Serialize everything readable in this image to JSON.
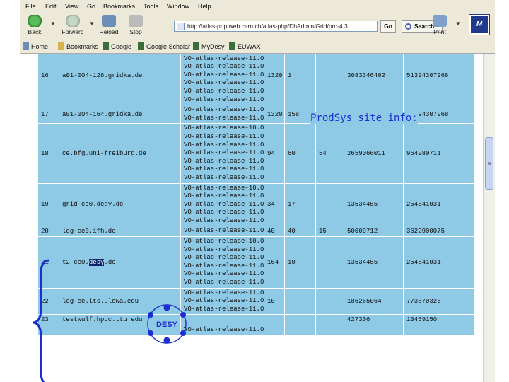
{
  "menu": [
    "File",
    "Edit",
    "View",
    "Go",
    "Bookmarks",
    "Tools",
    "Window",
    "Help"
  ],
  "toolbar": {
    "back": "Back",
    "forward": "Forward",
    "reload": "Reload",
    "stop": "Stop",
    "address": "http://atlas-php.web.cern.ch/atlas-php/DbAdmin/Grid/pro-4.3.",
    "go": "Go",
    "search": "Search",
    "print": "Print"
  },
  "logo": "M",
  "bookmarks": [
    "Home",
    "Bookmarks",
    "Google",
    "Google Scholar",
    "MyDesy",
    "EUWAX"
  ],
  "overlay_title": "ProdSys site info:",
  "desy_logo": "DESY",
  "colors": {
    "table_bg": "#8ecae6",
    "accent": "#1b2fd0",
    "chrome": "#ece9d8"
  },
  "rows": [
    {
      "num": "16",
      "host": "a01-004-128.gridka.de",
      "sw": [
        "VO-atlas-release-10.0.1",
        "VO-atlas-release-11.0.1",
        "VO-atlas-release-11.0.2",
        "VO-atlas-release-11.0.3",
        "VO-atlas-release-11.0.4",
        "VO-atlas-release-11.0.41",
        "VO-atlas-release-11.0.42"
      ],
      "c1": "1320",
      "c2": "1",
      "c3": "",
      "c4": "3083346402",
      "c5": "51394307968"
    },
    {
      "num": "17",
      "host": "a01-004-164.gridka.de",
      "sw": [
        "VO-atlas-release-11.0.2",
        "VO-atlas-release-11.0.3"
      ],
      "c1": "1320",
      "c2": "158",
      "c3": "",
      "c4": "3083346402",
      "c5": "51394307968"
    },
    {
      "num": "18",
      "host": "ce.bfg.uni-freiburg.de",
      "sw": [
        "VO-atlas-release-10.0.4",
        "VO-atlas-release-11.0.1",
        "VO-atlas-release-11.0.2",
        "VO-atlas-release-11.0.3",
        "VO-atlas-release-11.0.4",
        "VO-atlas-release-11.0.41",
        "VO-atlas-release-11.0.42"
      ],
      "c1": "94",
      "c2": "60",
      "c3": "54",
      "c4": "2659066011",
      "c5": "964980711"
    },
    {
      "num": "19",
      "host": "grid-ce0.desy.de",
      "sw": [
        "VO-atlas-release-10.0.4",
        "VO-atlas-release-11.0.2",
        "VO-atlas-release-11.0.3",
        "VO-atlas-release-11.0.4",
        "VO-atlas-release-11.0.41"
      ],
      "c1": "34",
      "c2": "17",
      "c3": "",
      "c4": "13534455",
      "c5": "254841031"
    },
    {
      "num": "20",
      "host": "lcg-ce0.ifh.de",
      "sw": [
        "VO-atlas-release-11.0.42"
      ],
      "c1": "40",
      "c2": "40",
      "c3": "15",
      "c4": "50009712",
      "c5": "3622900075"
    },
    {
      "num": "21",
      "host_pre": "t2-ce0.",
      "host_hl": "desy",
      "host_post": ".de",
      "sw": [
        "VO-atlas-release-10.0.4",
        "VO-atlas-release-11.0.1",
        "VO-atlas-release-11.0.3",
        "VO-atlas-release-11.0.7",
        "VO-atlas-release-11.0.4",
        "VO-atlas-release-11.0.41"
      ],
      "c1": "164",
      "c2": "10",
      "c3": "",
      "c4": "13534455",
      "c5": "254841031"
    },
    {
      "num": "22",
      "host": "lcg-ce.lts.ulowa.edu",
      "sw": [
        "VO-atlas-release-11.0.4",
        "VO-atlas-release-11.0.41",
        "VO-atlas-release-11.0.42"
      ],
      "c1": "10",
      "c2": "",
      "c3": "",
      "c4": "186265064",
      "c5": "773870328"
    },
    {
      "num": "23",
      "host": "testwulf.hpcc.ttu.edu",
      "sw": [
        ""
      ],
      "c1": "",
      "c2": "",
      "c3": "",
      "c4": "427306",
      "c5": "10469150"
    },
    {
      "num": "",
      "host": "",
      "sw": [
        "VO-atlas-release-11.0.4"
      ],
      "c1": "",
      "c2": "",
      "c3": "",
      "c4": "",
      "c5": ""
    }
  ]
}
